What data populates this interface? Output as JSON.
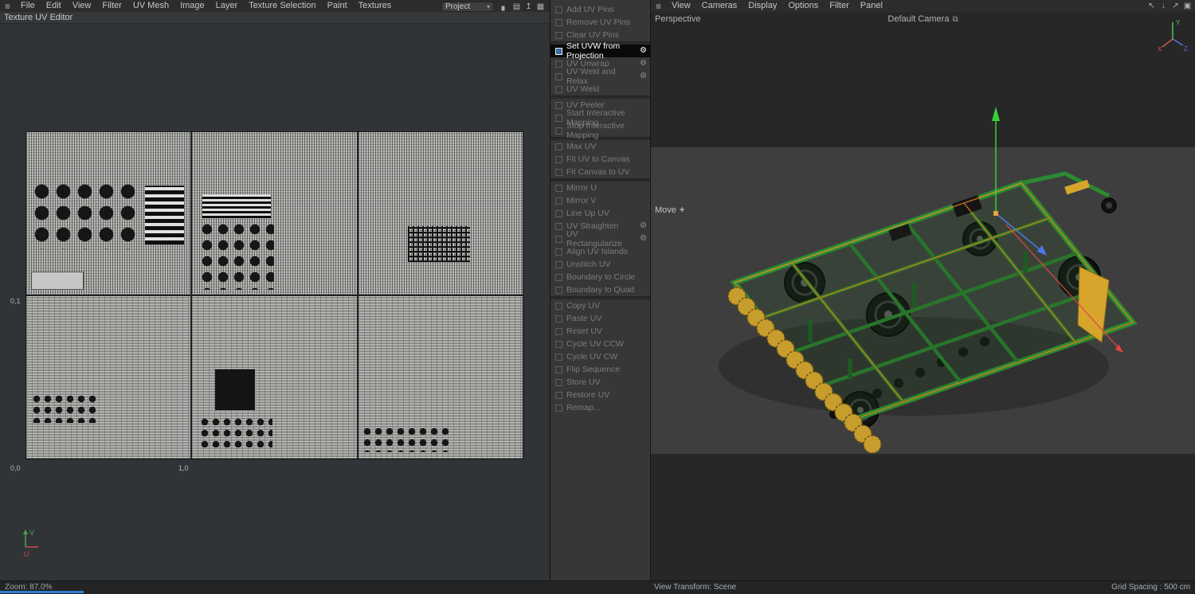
{
  "menubar_left": {
    "items": [
      "File",
      "Edit",
      "View",
      "Filter",
      "UV Mesh",
      "Image",
      "Layer",
      "Texture Selection",
      "Paint",
      "Textures"
    ]
  },
  "menubar_right": {
    "items": [
      "View",
      "Cameras",
      "Display",
      "Options",
      "Filter",
      "Panel"
    ]
  },
  "left_panel": {
    "title": "Texture UV Editor"
  },
  "toolbar": {
    "project_label": "Project",
    "caret": "▾",
    "center_icons": [
      {
        "name": "chart-icon",
        "glyph": "▖"
      },
      {
        "name": "render-lock-icon",
        "glyph": "▤"
      },
      {
        "name": "upload-icon",
        "glyph": "↥"
      },
      {
        "name": "palette-icon",
        "glyph": "▦"
      }
    ],
    "right_icons": [
      {
        "name": "pointer-icon",
        "glyph": "↖"
      },
      {
        "name": "download-icon",
        "glyph": "↓"
      },
      {
        "name": "external-window-icon",
        "glyph": "↗"
      },
      {
        "name": "layout-icon",
        "glyph": "▣"
      }
    ],
    "hamburger": "≡"
  },
  "uv_editor": {
    "labels": {
      "top_left": "0,1",
      "bottom_left": "0,0",
      "bottom_right": "1,0"
    },
    "axis": {
      "v": "V",
      "u": "U"
    }
  },
  "command_panel": {
    "groups": [
      {
        "items": [
          {
            "label": "Add UV Pins",
            "icon": "pin-add-icon"
          },
          {
            "label": "Remove UV Pins",
            "icon": "pin-remove-icon"
          },
          {
            "label": "Clear UV Pins",
            "icon": "pin-clear-icon"
          }
        ]
      },
      {
        "items": [
          {
            "label": "Set UVW from Projection",
            "icon": "uvw-projection-icon",
            "selected": true,
            "enabled": true,
            "gear": true
          },
          {
            "label": "UV Unwrap",
            "icon": "uv-unwrap-icon",
            "gear": true
          },
          {
            "label": "UV Weld and Relax",
            "icon": "uv-weld-relax-icon",
            "gear": true
          },
          {
            "label": "UV Weld",
            "icon": "uv-weld-icon"
          }
        ]
      },
      {
        "items": [
          {
            "label": "UV Peeler",
            "icon": "uv-peeler-icon"
          },
          {
            "label": "Start Interactive Mapping",
            "icon": "start-interactive-mapping-icon"
          },
          {
            "label": "Stop Interactive Mapping",
            "icon": "stop-interactive-mapping-icon"
          }
        ]
      },
      {
        "items": [
          {
            "label": "Max UV",
            "icon": "max-uv-icon"
          },
          {
            "label": "Fit UV to Canvas",
            "icon": "fit-uv-to-canvas-icon"
          },
          {
            "label": "Fit Canvas to UV",
            "icon": "fit-canvas-to-uv-icon"
          }
        ]
      },
      {
        "items": [
          {
            "label": "Mirror U",
            "icon": "mirror-u-icon"
          },
          {
            "label": "Mirror V",
            "icon": "mirror-v-icon"
          },
          {
            "label": "Line Up UV",
            "icon": "line-up-uv-icon"
          },
          {
            "label": "UV Straighten",
            "icon": "uv-straighten-icon",
            "gear": true
          },
          {
            "label": "UV Rectangularize",
            "icon": "uv-rectangularize-icon",
            "gear": true
          },
          {
            "label": "Align UV Islands",
            "icon": "align-uv-islands-icon"
          },
          {
            "label": "Unstitch UV",
            "icon": "unstitch-uv-icon"
          },
          {
            "label": "Boundary to Circle",
            "icon": "boundary-to-circle-icon"
          },
          {
            "label": "Boundary to Quad",
            "icon": "boundary-to-quad-icon"
          }
        ]
      },
      {
        "items": [
          {
            "label": "Copy UV",
            "icon": "copy-uv-icon"
          },
          {
            "label": "Paste UV",
            "icon": "paste-uv-icon"
          },
          {
            "label": "Reset UV",
            "icon": "reset-uv-icon"
          },
          {
            "label": "Cycle UV CCW",
            "icon": "cycle-uv-ccw-icon"
          },
          {
            "label": "Cycle UV CW",
            "icon": "cycle-uv-cw-icon"
          },
          {
            "label": "Flip Sequence",
            "icon": "flip-sequence-icon"
          },
          {
            "label": "Store UV",
            "icon": "store-uv-icon"
          },
          {
            "label": "Restore UV",
            "icon": "restore-uv-icon"
          },
          {
            "label": "Remap...",
            "icon": "remap-icon"
          }
        ]
      }
    ]
  },
  "viewport": {
    "view_label": "Perspective",
    "camera_label": "Default Camera",
    "camera_icon_glyph": "⧉",
    "tool_label": "Move",
    "tool_icon_glyph": "+"
  },
  "gizmo": {
    "x": "X",
    "y": "Y",
    "z": "Z"
  },
  "statusbar": {
    "zoom": "Zoom: 87.0%",
    "view_transform": "View Transform: Scene",
    "grid_spacing": "Grid Spacing : 500 cm"
  },
  "colors": {
    "accent_blue": "#2e7cd6",
    "machine_green": "#2c8a31",
    "roller_yellow": "#c79d2e",
    "selection_orange": "#df7f1c"
  }
}
